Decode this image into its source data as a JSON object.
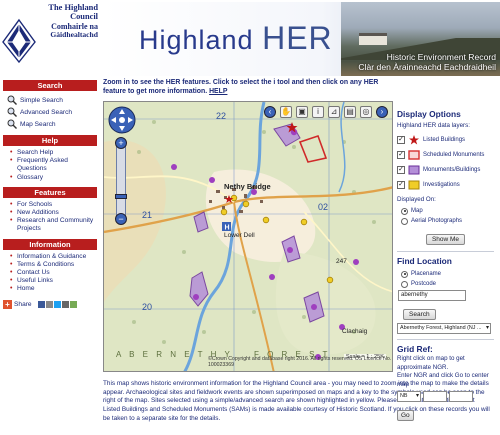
{
  "header": {
    "logo_line1": "The Highland",
    "logo_line2": "Council",
    "logo_line3": "Comhairle na",
    "logo_line4": "Gàidhealtachd",
    "title_main": "Highland",
    "title_her": "HER",
    "subtitle_en": "Historic Environment Record",
    "subtitle_gd": "Clàr den Àrainneachd Eachdraidheil"
  },
  "sidebar": {
    "search": {
      "heading": "Search",
      "items": [
        "Simple Search",
        "Advanced Search",
        "Map Search"
      ]
    },
    "help": {
      "heading": "Help",
      "items": [
        "Search Help",
        "Frequently Asked Questions",
        "Glossary"
      ]
    },
    "features": {
      "heading": "Features",
      "items": [
        "For Schools",
        "New Additions",
        "Research and Community Projects"
      ]
    },
    "information": {
      "heading": "Information",
      "items": [
        "Information & Guidance",
        "Terms & Conditions",
        "Contact Us",
        "Useful Links",
        "Home"
      ]
    },
    "share_label": "Share"
  },
  "intro": {
    "text": "Zoom in to see the HER features. Click to select the i tool and then click on any HER feature to get more information.",
    "help_link": "HELP"
  },
  "map": {
    "labels": {
      "nethy_bridge": "Nethy Bridge",
      "lower_dell": "Lower Dell",
      "grid_22": "22",
      "grid_02": "02",
      "grid_21": "21",
      "grid_20": "20",
      "clachaig": "Clachaig",
      "abernethy": "A B E R N E T H Y",
      "spot_247": "247",
      "forest_text": "F O R E S T"
    },
    "copyright": "©Crown Copyright and database right 2016. All rights reserved. OS Licence No. 100023369",
    "scale": "Scale = 1 : 25K",
    "toolbar_icons": [
      "back-icon",
      "pan-icon",
      "zoom-box-icon",
      "info-icon",
      "measure-icon",
      "print-icon",
      "globe-icon",
      "forward-icon"
    ]
  },
  "description": {
    "text": "This map shows historic environment information for the Highland Council area - you may need to zoom into the map to make the details appear. Archaeological sites and fieldwork events are shown superimposed on maps and a key to the symbols used can be seen to the right of the map. Sites selected using a simple/advanced search are shown highlighted in yellow. Please note that information about Listed Buildings and Scheduled Monuments (SAMs) is made available courtesy of Historic Scotland. If you click on these records you will be taken to a separate site for the details."
  },
  "right_panel": {
    "display_heading": "Display Options",
    "layers_label": "Highland HER data layers:",
    "layers": [
      {
        "label": "Listed Buildings",
        "checked": true,
        "color": "#c01818"
      },
      {
        "label": "Scheduled Monuments",
        "checked": true,
        "color": "#d63030"
      },
      {
        "label": "Monuments/Buildings",
        "checked": true,
        "color": "#9f3fbf"
      },
      {
        "label": "Investigations",
        "checked": true,
        "color": "#e5c01e"
      }
    ],
    "displayed_on_label": "Displayed On:",
    "display_options": [
      {
        "label": "Map",
        "selected": true
      },
      {
        "label": "Aerial Photographs",
        "selected": false
      }
    ],
    "show_me_button": "Show Me",
    "find_heading": "Find Location",
    "find_options": [
      {
        "label": "Placename",
        "selected": true
      },
      {
        "label": "Postcode",
        "selected": false
      }
    ],
    "find_input_value": "abernethy",
    "search_button": "Search",
    "result_select_value": "Abernethy Forest, Highland (NJ ...",
    "gridref_heading": "Grid Ref:",
    "gridref_text1": "Right click on map to get approximate NGR.",
    "gridref_text2": "Enter NGR and click Go to center map",
    "ngr_prefix_value": "NB",
    "go_button": "Go"
  }
}
